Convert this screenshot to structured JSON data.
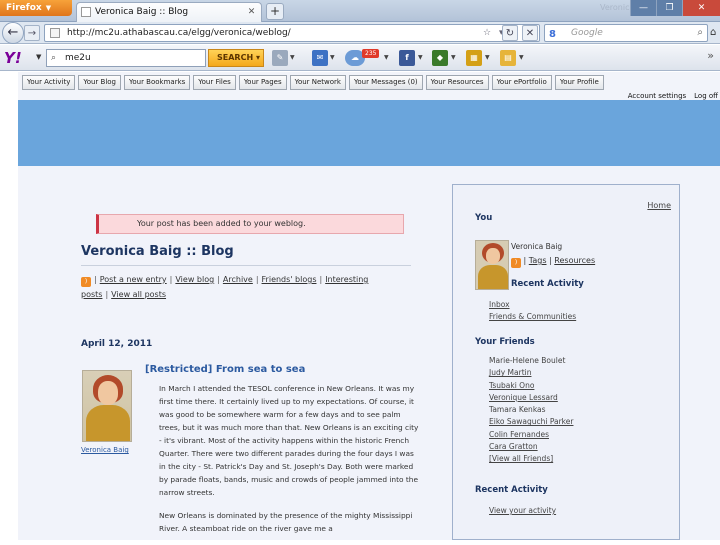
{
  "browser": {
    "menu_button": "Firefox",
    "tab_title": "Veronica Baig :: Blog",
    "new_tab": "+",
    "background_title": "Veronica Baig",
    "url": "http://mc2u.athabascau.ca/elgg/veronica/weblog/",
    "search_engine": "Google"
  },
  "yahoo_toolbar": {
    "logo": "Y!",
    "search_value": "me2u",
    "search_button": "SEARCH",
    "mail_badge": "235"
  },
  "site_nav": [
    "Your Activity",
    "Your Blog",
    "Your Bookmarks",
    "Your Files",
    "Your Pages",
    "Your Network",
    "Your Messages (0)",
    "Your Resources",
    "Your ePortfolio",
    "Your Profile"
  ],
  "account": {
    "settings": "Account settings",
    "logoff": "Log off"
  },
  "notice": "Your post has been added to your weblog.",
  "blog": {
    "title": "Veronica Baig :: Blog",
    "links": [
      "Post a new entry",
      "View blog",
      "Archive",
      "Friends' blogs",
      "Interesting posts",
      "View all posts"
    ]
  },
  "post": {
    "date": "April 12, 2011",
    "title": "[Restricted] From sea to sea",
    "author": "Veronica Baig",
    "para1": "In March I attended the TESOL conference in New Orleans. It was my first time there. It certainly lived up to my expectations. Of course, it was good to be somewhere warm for a few days and to see palm trees, but it was much more than that. New Orleans is an exciting city - it's vibrant. Most of the activity happens within the historic French Quarter. There were two different parades during the four days I was in the city - St. Patrick's Day and St. Joseph's Day. Both were marked by parade floats, bands, music and crowds of people jammed into the narrow streets.",
    "para2": "New Orleans is dominated by the presence of the mighty Mississippi River. A steamboat ride on the river gave me a"
  },
  "sidebar": {
    "home": "Home",
    "you_heading": "You",
    "name": "Veronica Baig",
    "tags": "Tags",
    "resources": "Resources",
    "recent_activity_heading": "Recent Activity",
    "you_links": [
      "Inbox",
      "Friends & Communities"
    ],
    "friends_heading": "Your Friends",
    "friends": [
      "Marie-Helene Boulet",
      "Judy Martin",
      "Tsubaki Ono",
      "Veronique Lessard",
      "Tamara Kenkas",
      "Eiko Sawaguchi Parker",
      "Colin Fernandes",
      "Cara Gratton",
      "[View all Friends]"
    ],
    "recent_activity_heading2": "Recent Activity",
    "recent_activity_link": "View your activity"
  },
  "colors": {
    "banner": "#6aa5dc",
    "heading": "#1d3561",
    "link": "#2c5aa0",
    "notice_bg": "#fbd9dc"
  }
}
